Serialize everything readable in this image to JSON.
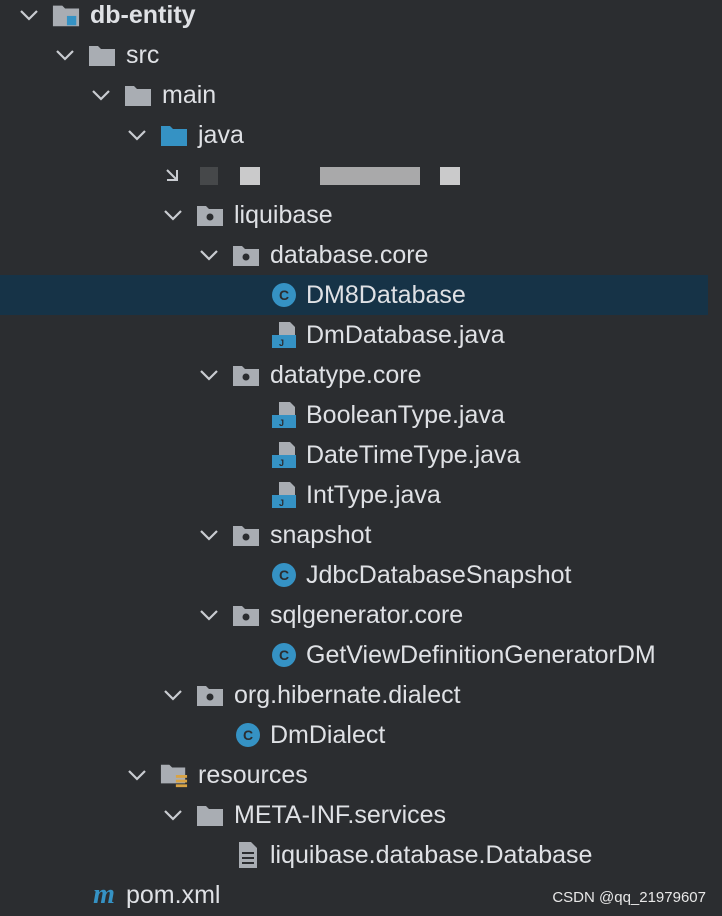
{
  "tree": {
    "module": "db-entity",
    "src": "src",
    "main": "main",
    "java": "java",
    "pkg_liquibase": "liquibase",
    "pkg_database_core": "database.core",
    "cls_dm8": "DM8Database",
    "file_dmdatabase": "DmDatabase.java",
    "pkg_datatype_core": "datatype.core",
    "file_boolean": "BooleanType.java",
    "file_datetime": "DateTimeType.java",
    "file_int": "IntType.java",
    "pkg_snapshot": "snapshot",
    "cls_jdbc_snapshot": "JdbcDatabaseSnapshot",
    "pkg_sqlgenerator_core": "sqlgenerator.core",
    "cls_getview": "GetViewDefinitionGeneratorDM",
    "pkg_hibernate": "org.hibernate.dialect",
    "cls_dmdialect": "DmDialect",
    "resources": "resources",
    "meta_inf": "META-INF.services",
    "file_liquibase_db": "liquibase.database.Database",
    "pom": "pom.xml",
    "pom_icon_letter": "m"
  },
  "watermark": "CSDN @qq_21979607",
  "colors": {
    "background": "#2b2d30",
    "selection": "#163347",
    "folder_gray": "#a9adb3",
    "source_folder_blue": "#3592c4",
    "class_blue": "#3592c4"
  },
  "icons": {
    "chevron": "chevron-down-icon",
    "folder": "folder-icon",
    "package": "package-icon",
    "class": "class-icon",
    "java_file": "java-file-icon",
    "text_file": "text-file-icon",
    "maven": "maven-icon"
  }
}
